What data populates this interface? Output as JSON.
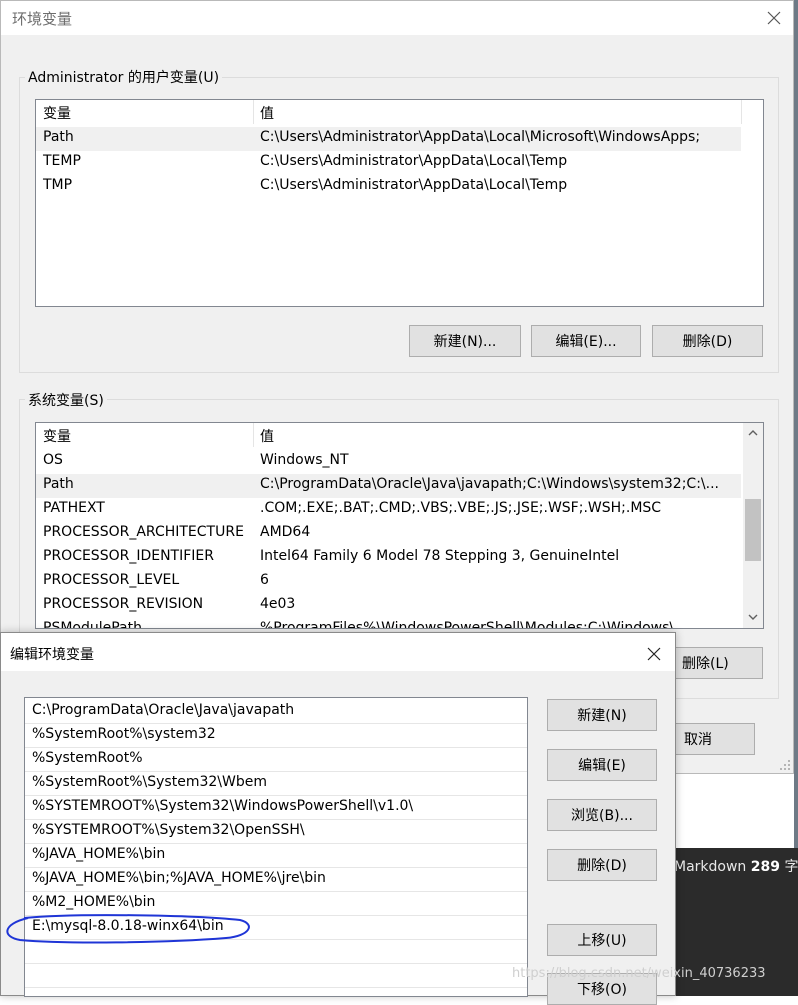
{
  "main_dialog": {
    "title": "环境变量",
    "user_group_label": "Administrator 的用户变量(U)",
    "user_columns": [
      "变量",
      "值"
    ],
    "user_vars": [
      {
        "name": "Path",
        "value": "C:\\Users\\Administrator\\AppData\\Local\\Microsoft\\WindowsApps;",
        "selected": true
      },
      {
        "name": "TEMP",
        "value": "C:\\Users\\Administrator\\AppData\\Local\\Temp"
      },
      {
        "name": "TMP",
        "value": "C:\\Users\\Administrator\\AppData\\Local\\Temp"
      }
    ],
    "user_buttons": {
      "new": "新建(N)...",
      "edit": "编辑(E)...",
      "delete": "删除(D)"
    },
    "system_group_label": "系统变量(S)",
    "system_columns": [
      "变量",
      "值"
    ],
    "system_vars": [
      {
        "name": "OS",
        "value": "Windows_NT"
      },
      {
        "name": "Path",
        "value": "C:\\ProgramData\\Oracle\\Java\\javapath;C:\\Windows\\system32;C:\\...",
        "selected": true
      },
      {
        "name": "PATHEXT",
        "value": ".COM;.EXE;.BAT;.CMD;.VBS;.VBE;.JS;.JSE;.WSF;.WSH;.MSC"
      },
      {
        "name": "PROCESSOR_ARCHITECTURE",
        "value": "AMD64"
      },
      {
        "name": "PROCESSOR_IDENTIFIER",
        "value": "Intel64 Family 6 Model 78 Stepping 3, GenuineIntel"
      },
      {
        "name": "PROCESSOR_LEVEL",
        "value": "6"
      },
      {
        "name": "PROCESSOR_REVISION",
        "value": "4e03"
      },
      {
        "name": "PSModulePath",
        "value": "%ProgramFiles%\\WindowsPowerShell\\Modules;C:\\Windows\\..."
      }
    ],
    "system_delete_label": "删除(L)",
    "cancel_label": "取消"
  },
  "edit_dialog": {
    "title": "编辑环境变量",
    "entries": [
      "C:\\ProgramData\\Oracle\\Java\\javapath",
      "%SystemRoot%\\system32",
      "%SystemRoot%",
      "%SystemRoot%\\System32\\Wbem",
      "%SYSTEMROOT%\\System32\\WindowsPowerShell\\v1.0\\",
      "%SYSTEMROOT%\\System32\\OpenSSH\\",
      "%JAVA_HOME%\\bin",
      "%JAVA_HOME%\\bin;%JAVA_HOME%\\jre\\bin",
      "%M2_HOME%\\bin",
      "E:\\mysql-8.0.18-winx64\\bin"
    ],
    "buttons": {
      "new": "新建(N)",
      "edit": "编辑(E)",
      "browse": "浏览(B)...",
      "delete": "删除(D)",
      "move_up": "上移(U)",
      "move_down": "下移(O)"
    }
  },
  "background": {
    "markdown_label": "Markdown",
    "word_count": "289",
    "word_unit": "字数"
  },
  "watermark": "https://blog.csdn.net/weixin_40736233",
  "colors": {
    "dialog_bg": "#f0f0f0",
    "annotation_ellipse": "#1f35d6"
  }
}
